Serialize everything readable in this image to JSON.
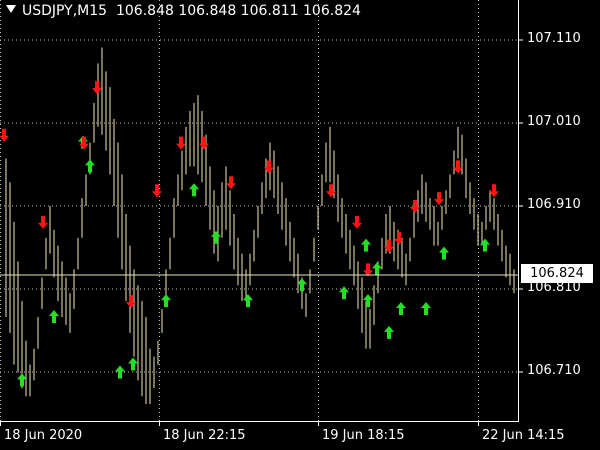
{
  "header": {
    "symbol_timeframe": "USDJPY,M15",
    "ohlc": "106.848 106.848 106.811 106.824"
  },
  "colors": {
    "background": "#000000",
    "grid": "#c0c0c0",
    "bars": "#f0e6b4",
    "bid_line": "#e6e6c0",
    "up_arrow": "#22e022",
    "down_arrow": "#ff1414",
    "text": "#ffffff"
  },
  "price_axis": {
    "labels": [
      "107.110",
      "107.010",
      "106.910",
      "106.810",
      "106.710"
    ],
    "current_price": "106.824"
  },
  "time_axis": {
    "labels": [
      "18 Jun 2020",
      "18 Jun 22:15",
      "19 Jun 18:15",
      "22 Jun 14:15"
    ]
  },
  "chart_data": {
    "type": "bar",
    "symbol": "USDJPY",
    "timeframe": "M15",
    "ylim": [
      106.65,
      107.18
    ],
    "bid": 106.824,
    "grid": true,
    "series": [
      {
        "name": "high",
        "values": [
          106.98,
          106.95,
          106.9,
          106.85,
          106.8,
          106.75,
          106.72,
          106.74,
          106.78,
          106.83,
          106.88,
          106.92,
          106.89,
          106.87,
          106.85,
          106.83,
          106.81,
          106.84,
          106.88,
          106.93,
          106.96,
          107.0,
          107.05,
          107.1,
          107.12,
          107.09,
          107.07,
          107.03,
          107.0,
          106.96,
          106.91,
          106.87,
          106.84,
          106.82,
          106.8,
          106.78,
          106.74,
          106.73,
          106.75,
          106.79,
          106.84,
          106.88,
          106.93,
          106.96,
          106.99,
          107.02,
          107.04,
          107.05,
          107.06,
          107.04,
          107.01,
          106.97,
          106.94,
          106.92,
          106.95,
          106.97,
          106.94,
          106.91,
          106.88,
          106.86,
          106.84,
          106.86,
          106.89,
          106.92,
          106.95,
          106.98,
          107.0,
          106.99,
          106.97,
          106.95,
          106.93,
          106.9,
          106.88,
          106.86,
          106.83,
          106.81,
          106.84,
          106.88,
          106.92,
          106.96,
          107.0,
          107.02,
          106.99,
          106.96,
          106.93,
          106.91,
          106.89,
          106.87,
          106.85,
          106.83,
          106.8,
          106.79,
          106.82,
          106.85,
          106.88,
          106.91,
          106.92,
          106.9,
          106.89,
          106.88,
          106.86,
          106.88,
          106.92,
          106.94,
          106.96,
          106.95,
          106.93,
          106.92,
          106.9,
          106.92,
          106.94,
          106.96,
          106.99,
          107.02,
          107.01,
          106.98,
          106.95,
          106.93,
          106.91,
          106.9,
          106.92,
          106.94,
          106.93,
          106.91,
          106.89,
          106.87,
          106.86,
          106.84
        ]
      },
      {
        "name": "low",
        "values": [
          106.78,
          106.76,
          106.72,
          106.71,
          106.69,
          106.68,
          106.68,
          106.7,
          106.74,
          106.79,
          106.84,
          106.86,
          106.83,
          106.8,
          106.78,
          106.77,
          106.76,
          106.79,
          106.84,
          106.88,
          106.92,
          106.96,
          107.0,
          107.02,
          107.01,
          106.99,
          106.96,
          106.92,
          106.88,
          106.84,
          106.8,
          106.76,
          106.73,
          106.7,
          106.68,
          106.67,
          106.67,
          106.69,
          106.72,
          106.76,
          106.8,
          106.84,
          106.88,
          106.92,
          106.94,
          106.96,
          106.97,
          106.97,
          106.96,
          106.95,
          106.92,
          106.89,
          106.86,
          106.85,
          106.88,
          106.89,
          106.87,
          106.84,
          106.82,
          106.8,
          106.8,
          106.82,
          106.85,
          106.88,
          106.91,
          106.93,
          106.94,
          106.93,
          106.91,
          106.89,
          106.87,
          106.85,
          106.83,
          106.81,
          106.79,
          106.78,
          106.81,
          106.85,
          106.89,
          106.92,
          106.95,
          106.95,
          106.93,
          106.9,
          106.88,
          106.86,
          106.84,
          106.82,
          106.79,
          106.76,
          106.74,
          106.74,
          106.77,
          106.81,
          106.84,
          106.86,
          106.86,
          106.85,
          106.84,
          106.83,
          106.82,
          106.85,
          106.88,
          106.9,
          106.91,
          106.9,
          106.89,
          106.87,
          106.87,
          106.89,
          106.91,
          106.93,
          106.96,
          106.98,
          106.96,
          106.93,
          106.91,
          106.89,
          106.87,
          106.87,
          106.89,
          106.9,
          106.89,
          106.87,
          106.85,
          106.83,
          106.82,
          106.81
        ]
      }
    ],
    "signals": {
      "up_arrow_values": [
        106.7,
        106.78,
        106.71,
        106.72,
        106.8,
        106.97,
        107.0,
        106.94,
        106.88,
        106.8,
        106.82,
        106.81,
        106.8,
        106.84,
        106.76,
        106.79,
        106.79,
        106.86,
        106.87,
        106.87
      ],
      "down_arrow_values": [
        107.01,
        106.9,
        107.07,
        107.0,
        106.8,
        106.94,
        107.0,
        107.0,
        106.95,
        106.97,
        106.94,
        106.9,
        106.84,
        106.87,
        106.88,
        106.92,
        106.93,
        106.97,
        106.94
      ]
    }
  }
}
